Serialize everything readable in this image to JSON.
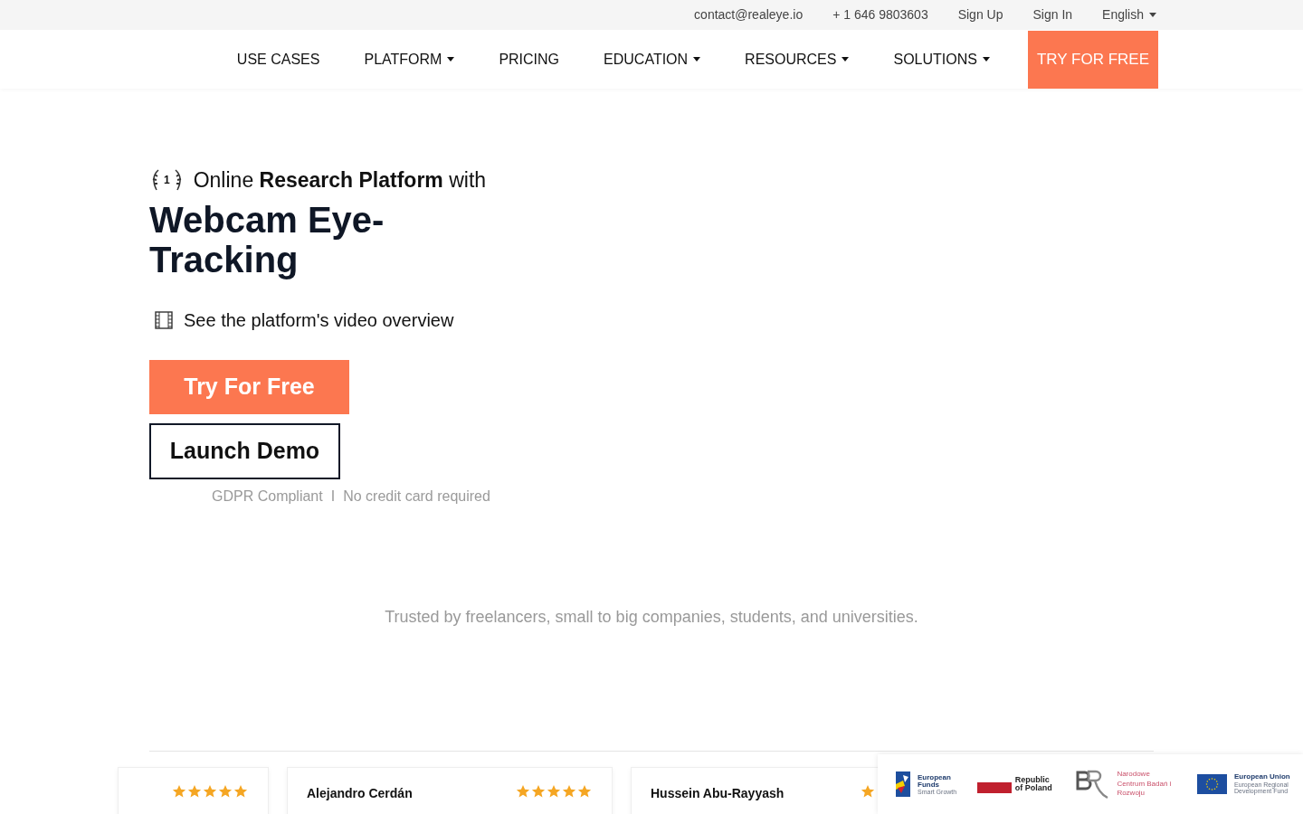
{
  "top_bar": {
    "email": "contact@realeye.io",
    "phone": "+ 1 646 9803603",
    "links": [
      "Sign Up",
      "Sign In"
    ],
    "language": "English"
  },
  "nav": {
    "items": [
      {
        "label": "USE CASES",
        "dropdown": false
      },
      {
        "label": "PLATFORM",
        "dropdown": true
      },
      {
        "label": "PRICING",
        "dropdown": false
      },
      {
        "label": "EDUCATION",
        "dropdown": true
      },
      {
        "label": "RESOURCES",
        "dropdown": true
      },
      {
        "label": "SOLUTIONS",
        "dropdown": true
      }
    ],
    "cta": "TRY FOR FREE"
  },
  "hero": {
    "badge": "1",
    "tagline": "Online **Research Platform** with",
    "title": "Webcam Eye-Tracking",
    "video_link": "See the platform's video overview",
    "primary_button": "Try For Free",
    "secondary_button": "Launch Demo",
    "notes": [
      "GDPR Compliant",
      "I",
      "No credit card required"
    ]
  },
  "trusted_by": "Trusted by freelancers, small to big companies, students, and universities.",
  "reviews": [
    {
      "stars": 5
    },
    {
      "name": "Alejandro Cerdán",
      "stars": 5
    },
    {
      "name": "Hussein Abu-Rayyash"
    }
  ],
  "funding_banner": {
    "logos": [
      {
        "kind": "eu_funds",
        "title": "European Funds",
        "subtitle": "Smart Growth"
      },
      {
        "kind": "flag",
        "title": "Republic of Poland"
      },
      {
        "kind": "ncbr",
        "title": "Narodowe Centrum Badań i Rozwoju"
      },
      {
        "kind": "eu",
        "title": "European Union",
        "subtitle": "European Regional Development Fund"
      }
    ]
  }
}
